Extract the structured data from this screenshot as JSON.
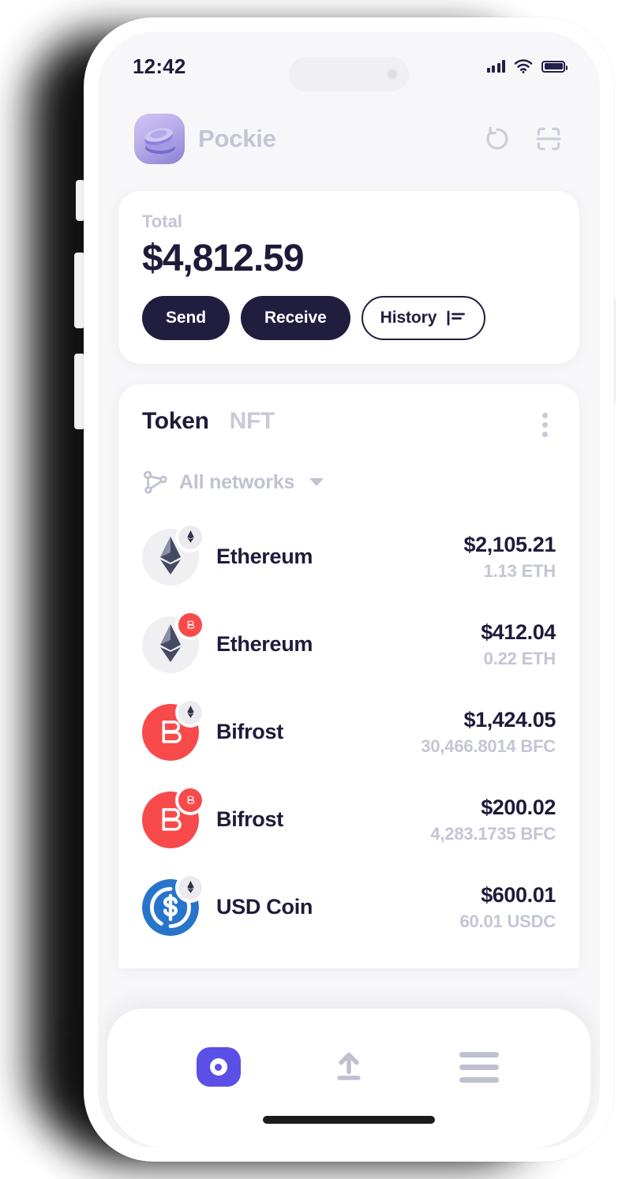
{
  "status_bar": {
    "time": "12:42",
    "signal_icon": "cellular-signal-icon",
    "wifi_icon": "wifi-icon",
    "battery_icon": "battery-full-icon"
  },
  "header": {
    "app_name": "Pockie",
    "logo_icon": "pockie-coin-stack-logo",
    "refresh_icon": "refresh-loop-icon",
    "scan_icon": "qr-scan-icon"
  },
  "balance_card": {
    "label": "Total",
    "amount": "$4,812.59",
    "buttons": [
      {
        "label": "Send",
        "style": "filled",
        "name": "send-button"
      },
      {
        "label": "Receive",
        "style": "filled",
        "name": "receive-button"
      },
      {
        "label": "History",
        "style": "outline",
        "name": "history-button",
        "icon": "history-list-icon"
      }
    ]
  },
  "token_card": {
    "tabs": [
      {
        "label": "Token",
        "active": true
      },
      {
        "label": "NFT",
        "active": false
      }
    ],
    "menu_icon": "kebab-menu-icon",
    "network_filter": {
      "label": "All networks",
      "icon": "network-nodes-icon",
      "caret": "chevron-down-icon"
    },
    "tokens": [
      {
        "name": "Ethereum",
        "fiat": "$2,105.21",
        "amount": "1.13 ETH",
        "icon": "ethereum-token-icon",
        "badge": "ethereum-network-badge"
      },
      {
        "name": "Ethereum",
        "fiat": "$412.04",
        "amount": "0.22 ETH",
        "icon": "ethereum-token-icon",
        "badge": "bifrost-network-badge"
      },
      {
        "name": "Bifrost",
        "fiat": "$1,424.05",
        "amount": "30,466.8014 BFC",
        "icon": "bifrost-token-icon",
        "badge": "ethereum-network-badge"
      },
      {
        "name": "Bifrost",
        "fiat": "$200.02",
        "amount": "4,283.1735 BFC",
        "icon": "bifrost-token-icon",
        "badge": "bifrost-network-badge"
      },
      {
        "name": "USD Coin",
        "fiat": "$600.01",
        "amount": "60.01 USDC",
        "icon": "usd-coin-token-icon",
        "badge": "ethereum-network-badge"
      }
    ]
  },
  "bottom_nav": {
    "items": [
      {
        "name": "nav-wallet",
        "icon": "wallet-icon",
        "active": true
      },
      {
        "name": "nav-send",
        "icon": "upload-arrow-icon",
        "active": false
      },
      {
        "name": "nav-menu",
        "icon": "hamburger-menu-icon",
        "active": false
      }
    ]
  },
  "colors": {
    "accent_purple": "#5b50e6",
    "dark_navy": "#1e1b3a",
    "bifrost_red": "#f84a4a",
    "usdc_blue": "#2775ca",
    "muted_gray": "#c3c5d4",
    "screen_bg": "#f7f7f9"
  }
}
